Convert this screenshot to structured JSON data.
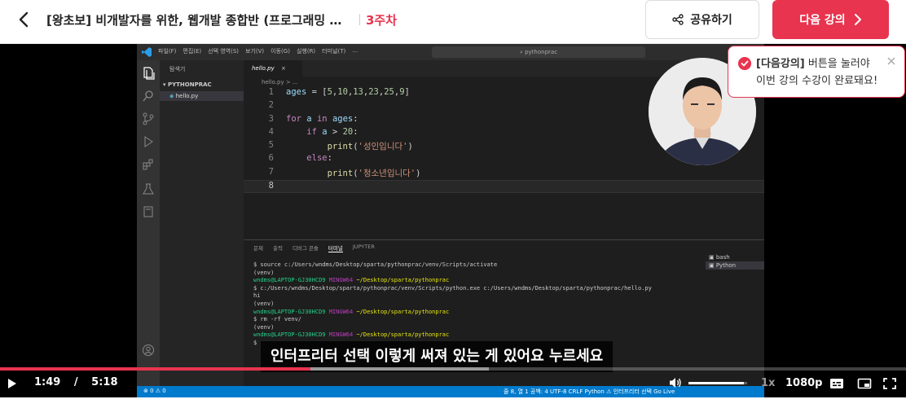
{
  "header": {
    "course_title": "[왕초보] 비개발자를 위한, 웹개발 종합반 (프로그래밍 실무...",
    "week_label": "3주차",
    "share_label": "공유하기",
    "next_label": "다음 강의",
    "accent_color": "#e8344e"
  },
  "tooltip": {
    "highlight": "[다음강의]",
    "line1_rest": " 버튼을 눌러야",
    "line2": "이번 강의 수강이 완료돼요!"
  },
  "vscode": {
    "menu": [
      "파일(F)",
      "편집(E)",
      "선택 영역(S)",
      "보기(V)",
      "이동(G)",
      "실행(R)",
      "터미널(T)",
      "…"
    ],
    "search_text": "pythonprac",
    "explorer_label": "탐색기",
    "folder_name": "PYTHONPRAC",
    "file_name": "hello.py",
    "tab_name": "hello.py",
    "breadcrumb": "hello.py > ...",
    "panel_tabs": [
      "문제",
      "출력",
      "디버그 콘솔",
      "터미널",
      "JUPYTER"
    ],
    "terminal_list": [
      "bash",
      "Python"
    ],
    "statusbar_left": "⊗ 0  ⚠ 0",
    "statusbar_right": "줄 8, 열 1   공백: 4   UTF-8   CRLF   Python   ⚠ 인터프리터 선택   Go Live"
  },
  "code_lines": [
    {
      "n": "1",
      "parts": [
        [
          "var",
          "ages"
        ],
        [
          "pl",
          " = ["
        ],
        [
          "num",
          "5"
        ],
        [
          "pl",
          ","
        ],
        [
          "num",
          "10"
        ],
        [
          "pl",
          ","
        ],
        [
          "num",
          "13"
        ],
        [
          "pl",
          ","
        ],
        [
          "num",
          "23"
        ],
        [
          "pl",
          ","
        ],
        [
          "num",
          "25"
        ],
        [
          "pl",
          ","
        ],
        [
          "num",
          "9"
        ],
        [
          "pl",
          "]"
        ]
      ]
    },
    {
      "n": "2",
      "parts": []
    },
    {
      "n": "3",
      "parts": [
        [
          "kw",
          "for"
        ],
        [
          "pl",
          " "
        ],
        [
          "var",
          "a"
        ],
        [
          "pl",
          " "
        ],
        [
          "kw",
          "in"
        ],
        [
          "pl",
          " "
        ],
        [
          "var",
          "ages"
        ],
        [
          "pl",
          ":"
        ]
      ]
    },
    {
      "n": "4",
      "parts": [
        [
          "pl",
          "    "
        ],
        [
          "kw",
          "if"
        ],
        [
          "pl",
          " "
        ],
        [
          "var",
          "a"
        ],
        [
          "pl",
          " > "
        ],
        [
          "num",
          "20"
        ],
        [
          "pl",
          ":"
        ]
      ]
    },
    {
      "n": "5",
      "parts": [
        [
          "pl",
          "        "
        ],
        [
          "fn",
          "print"
        ],
        [
          "pl",
          "("
        ],
        [
          "str",
          "'성인입니다'"
        ],
        [
          "pl",
          ")"
        ]
      ]
    },
    {
      "n": "6",
      "parts": [
        [
          "pl",
          "    "
        ],
        [
          "kw",
          "else"
        ],
        [
          "pl",
          ":"
        ]
      ]
    },
    {
      "n": "7",
      "parts": [
        [
          "pl",
          "        "
        ],
        [
          "fn",
          "print"
        ],
        [
          "pl",
          "("
        ],
        [
          "str",
          "'청소년입니다'"
        ],
        [
          "pl",
          ")"
        ]
      ]
    },
    {
      "n": "8",
      "parts": []
    }
  ],
  "terminal_lines": [
    [
      [
        "pl",
        "$ source c:/Users/wndms/Desktop/sparta/pythonprac/venv/Scripts/activate"
      ]
    ],
    [
      [
        "pl",
        "(venv)"
      ]
    ],
    [
      [
        "green",
        "wndms@LAPTOP-GJ30HCD9 "
      ],
      [
        "purple",
        "MINGW64 "
      ],
      [
        "yellow",
        "~/Desktop/sparta/pythonprac"
      ]
    ],
    [
      [
        "pl",
        "$ c:/Users/wndms/Desktop/sparta/pythonprac/venv/Scripts/python.exe c:/Users/wndms/Desktop/sparta/pythonprac/hello.py"
      ]
    ],
    [
      [
        "pl",
        "hi"
      ]
    ],
    [
      [
        "pl",
        "(venv)"
      ]
    ],
    [
      [
        "green",
        "wndms@LAPTOP-GJ30HCD9 "
      ],
      [
        "purple",
        "MINGW64 "
      ],
      [
        "yellow",
        "~/Desktop/sparta/pythonprac"
      ]
    ],
    [
      [
        "pl",
        "$ rm -rf venv/"
      ]
    ],
    [
      [
        "pl",
        "(venv)"
      ]
    ],
    [
      [
        "green",
        "wndms@LAPTOP-GJ30HCD9 "
      ],
      [
        "purple",
        "MINGW64 "
      ],
      [
        "yellow",
        "~/Desktop/sparta/pythonprac"
      ]
    ],
    [
      [
        "pl",
        "$"
      ]
    ]
  ],
  "player": {
    "subtitle": "인터프리터 선택 이렇게 써져 있는 게 있어요 누르세요",
    "current_time": "1:49",
    "separator": "/",
    "duration": "5:18",
    "progress_fraction": 0.343,
    "buffered_fraction": 0.54,
    "volume_fraction": 0.95,
    "speed": "1x",
    "quality": "1080p"
  }
}
